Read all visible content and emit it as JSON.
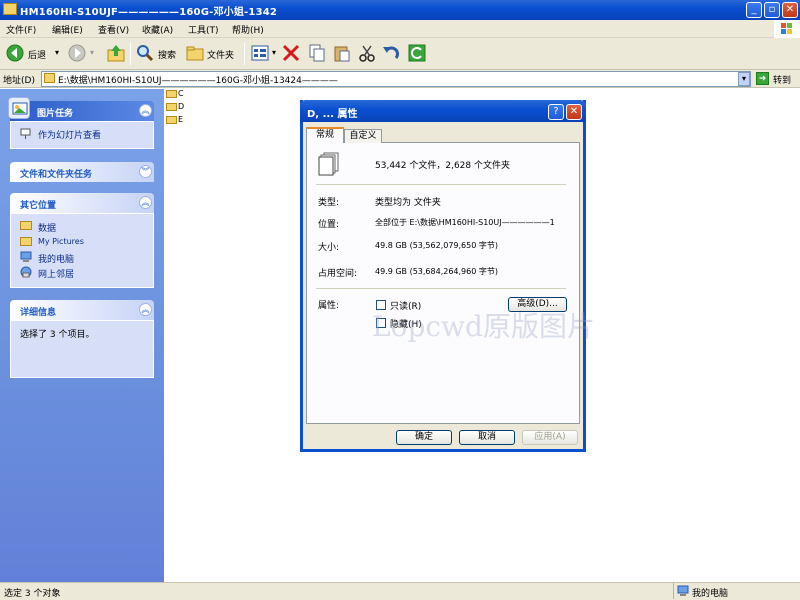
{
  "window": {
    "title": "HM160HI-S10UJF——————160G-邓小姐-1342"
  },
  "menu": [
    "文件(F)",
    "编辑(E)",
    "查看(V)",
    "收藏(A)",
    "工具(T)",
    "帮助(H)"
  ],
  "toolbar": {
    "back_label": "后退",
    "search_label": "搜索",
    "folders_label": "文件夹"
  },
  "address": {
    "label": "地址(D)",
    "value": "E:\\数据\\HM160HI-S10UJ——————160G-邓小姐-13424————",
    "go_label": "转到"
  },
  "left_pane": {
    "picture_tasks": {
      "title": "图片任务",
      "items": [
        "作为幻灯片查看"
      ]
    },
    "file_tasks": {
      "title": "文件和文件夹任务"
    },
    "other_places": {
      "title": "其它位置",
      "items": [
        "数据",
        "My Pictures",
        "我的电脑",
        "网上邻居"
      ]
    },
    "details": {
      "title": "详细信息",
      "text": "选择了 3 个项目。"
    }
  },
  "files": [
    "C",
    "D",
    "E"
  ],
  "dialog": {
    "title": "D, ... 属性",
    "tabs": [
      "常规",
      "自定义"
    ],
    "summary": "53,442 个文件，2,628 个文件夹",
    "type_label": "类型:",
    "type_value": "类型均为 文件夹",
    "location_label": "位置:",
    "location_value": "全部位于 E:\\数据\\HM160HI-S10UJ——————1",
    "size_label": "大小:",
    "size_value": "49.8 GB (53,562,079,650 字节)",
    "disk_label": "占用空间:",
    "disk_value": "49.9 GB (53,684,264,960 字节)",
    "attrs_label": "属性:",
    "readonly_label": "只读(R)",
    "hidden_label": "隐藏(H)",
    "advanced_label": "高级(D)...",
    "ok_label": "确定",
    "cancel_label": "取消",
    "apply_label": "应用(A)"
  },
  "watermark": "Lopcwd原版图片",
  "status": {
    "left": "选定 3 个对象",
    "right": "我的电脑"
  },
  "colors": {
    "titlebar": "#0a4fd0",
    "panel_bg": "#d6dff7",
    "pane_bg": "#6a8fdd",
    "chrome": "#ece9d8"
  }
}
